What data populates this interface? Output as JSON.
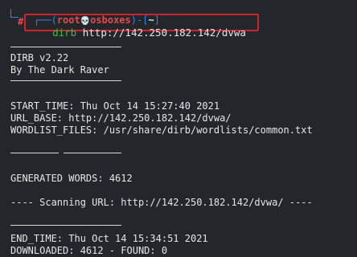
{
  "prompt": {
    "open_bracket": "┌──(",
    "user": "root",
    "skull": "💀",
    "host": "osboxes",
    "close_bracket": ")-[",
    "cwd": "~",
    "end_bracket": "]",
    "symbol": "#"
  },
  "command": {
    "exe": "dirb",
    "args": " http://142.250.182.142/dvwa"
  },
  "banner": {
    "line1": "DIRB v2.22",
    "line2": "By The Dark Raver"
  },
  "info": {
    "start_time": "START_TIME: Thu Oct 14 15:27:40 2021",
    "url_base": "URL_BASE: http://142.250.182.142/dvwa/",
    "wordlist": "WORDLIST_FILES: /usr/share/dirb/wordlists/common.txt"
  },
  "generated_words": "GENERATED WORDS: 4612",
  "scanning": "---- Scanning URL: http://142.250.182.142/dvwa/ ----",
  "end": {
    "end_time": "END_TIME: Thu Oct 14 15:34:51 2021",
    "downloaded": "DOWNLOADED: 4612 - FOUND: 0"
  },
  "colors": {
    "background": "#23262b",
    "text": "#e6e6e6",
    "prompt_bracket": "#3d7fe0",
    "user": "#e84a4a",
    "command_exe": "#3fb950",
    "highlight_box": "#c8262e"
  }
}
